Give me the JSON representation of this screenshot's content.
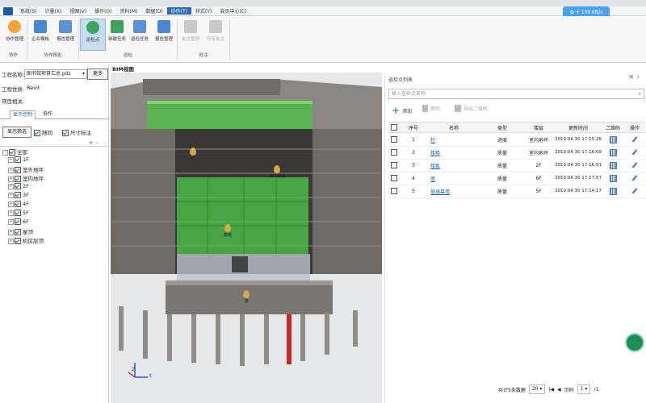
{
  "menu": {
    "items": [
      "系统(S)",
      "计量(X)",
      "视图(V)",
      "操作(O)",
      "资料(M)",
      "数据(D)",
      "协作(T)",
      "样式(Y)",
      "会员中心(C)"
    ],
    "active_index": 6
  },
  "network": {
    "speed": "+ 109 KB/s"
  },
  "ribbon": {
    "buttons": [
      {
        "label": "协作管理"
      },
      {
        "label": "企业模板"
      },
      {
        "label": "报告管理"
      },
      {
        "label": "巡检点"
      },
      {
        "label": "新建任务"
      },
      {
        "label": "巡检任务"
      },
      {
        "label": "报告管理"
      },
      {
        "label": "批注管理"
      },
      {
        "label": "所有批注"
      }
    ],
    "groups": [
      "协作",
      "协作报告",
      "巡检",
      "批注"
    ]
  },
  "left": {
    "project_name_label": "工程名称:",
    "project_file": "图书馆项目汇总.pds",
    "more_button": "更多",
    "project_type_label": "工程性质:",
    "project_type_value": "Revit",
    "project_related_label": "项目相关:",
    "tabs": [
      "显示控制",
      "协作"
    ],
    "show_filter": "显示筛选",
    "opt_follow": "随同",
    "opt_dimension": "尺寸标注",
    "tree": {
      "root": "全部",
      "items": [
        "1F",
        "室外地坪",
        "室内地坪",
        "2F",
        "3F",
        "4F",
        "5F",
        "6F",
        "屋顶",
        "机房层顶"
      ]
    }
  },
  "bim": {
    "tab_title": "BIM视图",
    "markers": [
      "柱",
      "玻璃幕墙",
      "楼板",
      "墙"
    ],
    "axis_z": "Z",
    "axis_x": "X"
  },
  "panel": {
    "title": "巡检点列表",
    "search_placeholder": "输入巡检点名称",
    "btn_add": "添加",
    "btn_delete": "删除",
    "btn_export_qr": "导出二维码",
    "columns": [
      "序号",
      "名称",
      "类型",
      "楼层",
      "更新时间",
      "二维码",
      "操作"
    ],
    "rows": [
      {
        "no": "1",
        "name": "柱",
        "type": "进度",
        "floor": "室内地坪",
        "time": "2019.04.30 17:15:26"
      },
      {
        "no": "2",
        "name": "楼梯",
        "type": "质量",
        "floor": "室内地坪",
        "time": "2019.04.30 17:16:09"
      },
      {
        "no": "3",
        "name": "楼板",
        "type": "质量",
        "floor": "2F",
        "time": "2019.04.30 17:16:51"
      },
      {
        "no": "4",
        "name": "墙",
        "type": "质量",
        "floor": "6F",
        "time": "2019.04.30 17:17:57"
      },
      {
        "no": "5",
        "name": "玻璃幕墙",
        "type": "质量",
        "floor": "5F",
        "time": "2019.04.30 17:14:17"
      }
    ],
    "pager": {
      "total_text": "共计5条数据",
      "page_size": "20",
      "page_label": "页码",
      "current_page": "1",
      "total_pages": "/1"
    }
  },
  "colors": {
    "accent": "#2b6cb0",
    "green_highlight": "#4cc94c",
    "building_gray": "#6e6a66"
  }
}
